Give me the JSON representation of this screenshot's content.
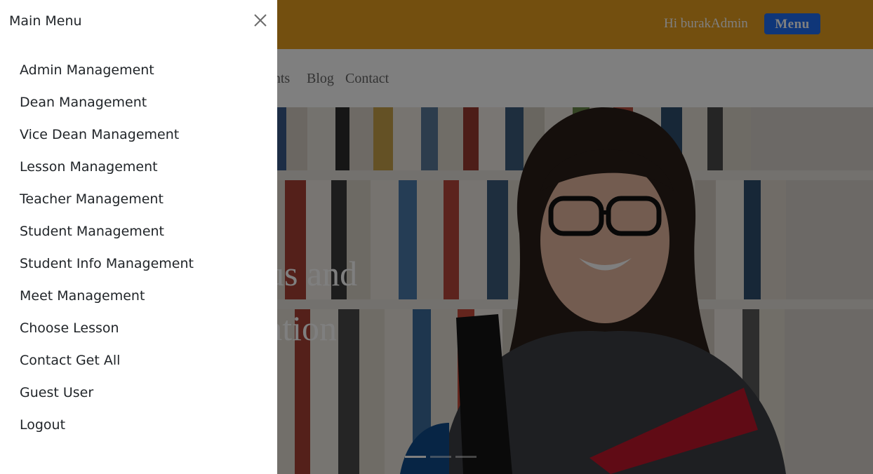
{
  "header": {
    "greeting": "Hi burakAdmin",
    "menu_label": "Menu",
    "colors": {
      "topbar": "#e79e1e",
      "menu_button": "#1e6cf2"
    }
  },
  "navbar": {
    "links": [
      "ents",
      "Blog",
      "Contact"
    ]
  },
  "hero": {
    "headline_line1": "us and",
    "headline_line2": "ation",
    "slide_indicators": 3,
    "active_slide": 1
  },
  "offcanvas": {
    "title": "Main Menu",
    "close_icon": "close-icon",
    "items": [
      "Admin Management",
      "Dean Management",
      "Vice Dean Management",
      "Lesson Management",
      "Teacher Management",
      "Student Management",
      "Student Info Management",
      "Meet Management",
      "Choose Lesson",
      "Contact Get All",
      "Guest User",
      "Logout"
    ]
  }
}
